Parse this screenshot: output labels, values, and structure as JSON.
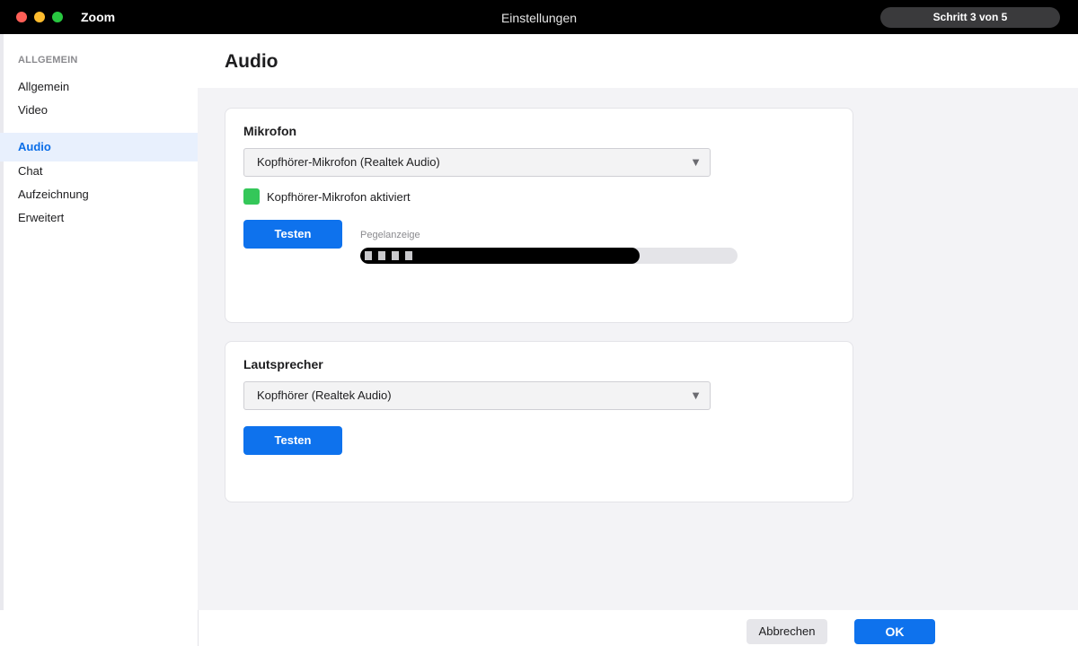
{
  "titlebar": {
    "app_name": "Zoom",
    "window_title": "Einstellungen",
    "step": "Schritt 3 von 5"
  },
  "sidebar": {
    "section_title": "ALLGEMEIN",
    "items": [
      {
        "label": "Allgemein",
        "active": false
      },
      {
        "label": "Video",
        "active": false
      },
      {
        "label": "Audio",
        "active": true
      },
      {
        "label": "Chat",
        "active": false
      },
      {
        "label": "Aufzeichnung",
        "active": false
      },
      {
        "label": "Erweitert",
        "active": false
      }
    ]
  },
  "main": {
    "title": "Audio",
    "microphone": {
      "title": "Mikrofon",
      "device": "Kopfhörer-Mikrofon (Realtek Audio)",
      "enabled": true,
      "enabled_label": "Kopfhörer-Mikrofon aktiviert",
      "test_label": "Testen",
      "meter_label": "Pegelanzeige",
      "meter_level": 0.74
    },
    "speaker": {
      "title": "Lautsprecher",
      "device": "Kopfhörer (Realtek Audio)",
      "test_label": "Testen"
    }
  },
  "footer": {
    "cancel_label": "Abbrechen",
    "ok_label": "OK"
  },
  "colors": {
    "accent": "#0e72ed",
    "check": "#34c759",
    "active_nav_bg": "#e8f0fd"
  },
  "icons": {
    "select_caret": "chevron-down-icon",
    "checkbox": "checkbox-icon"
  }
}
